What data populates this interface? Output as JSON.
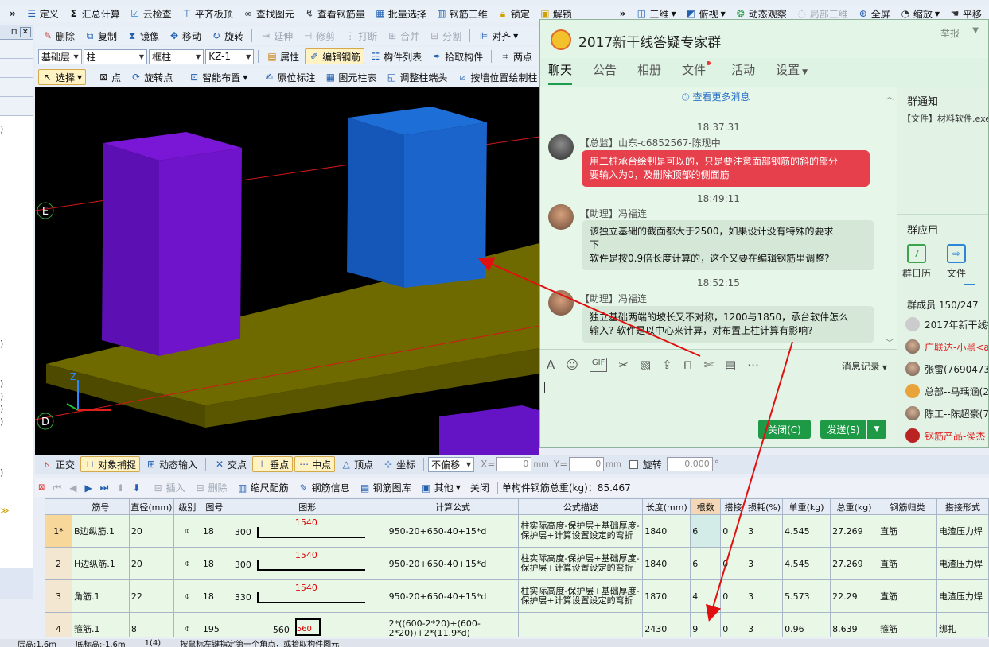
{
  "toolbar1": {
    "items": [
      "定义",
      "汇总计算",
      "云检查",
      "平齐板顶",
      "查找图元",
      "查看钢筋量",
      "批量选择",
      "钢筋三维",
      "锁定",
      "解锁"
    ],
    "right_items": [
      "三维",
      "俯视",
      "动态观察",
      "局部三维",
      "全屏",
      "缩放",
      "平移"
    ]
  },
  "toolbar2": {
    "items": [
      "删除",
      "复制",
      "镜像",
      "移动",
      "旋转",
      "延伸",
      "修剪",
      "打断",
      "合并",
      "分割",
      "对齐"
    ]
  },
  "toolbar3": {
    "layer": "基础层",
    "type": "柱",
    "subtype": "框柱",
    "component": "KZ-1",
    "items": [
      "属性",
      "编辑钢筋",
      "构件列表",
      "拾取构件",
      "两点"
    ]
  },
  "toolbar4": {
    "items": [
      "选择",
      "点",
      "旋转点",
      "智能布置",
      "原位标注",
      "图元柱表",
      "调整柱端头",
      "按墙位置绘制柱"
    ]
  },
  "viewport": {
    "axis_e": "E",
    "axis_d": "D",
    "z_label": "Z"
  },
  "snapbar": {
    "items": [
      "正交",
      "对象捕捉",
      "动态输入",
      "交点",
      "垂点",
      "中点",
      "顶点",
      "坐标"
    ],
    "offset_mode": "不偏移",
    "x_label": "X=",
    "x_value": "0",
    "x_unit": "mm",
    "y_label": "Y=",
    "y_value": "0",
    "y_unit": "mm",
    "rotate_label": "旋转",
    "rotate_value": "0.000",
    "rotate_unit": "°"
  },
  "rebarbar": {
    "items": [
      "插入",
      "删除",
      "缩尺配筋",
      "钢筋信息",
      "钢筋图库",
      "其他",
      "关闭"
    ],
    "total": "单构件钢筋总重(kg)：85.467"
  },
  "table": {
    "headers": [
      "",
      "筋号",
      "直径(mm)",
      "级别",
      "图号",
      "图形",
      "计算公式",
      "公式描述",
      "长度(mm)",
      "根数",
      "搭接",
      "损耗(%)",
      "单重(kg)",
      "总重(kg)",
      "钢筋归类",
      "搭接形式"
    ],
    "rows": [
      {
        "idx": "1*",
        "name": "B边纵筋.1",
        "dia": "20",
        "grade": "⌽",
        "fig": "18",
        "shape_left": "300",
        "shape_top": "1540",
        "formula": "950-20+650-40+15*d",
        "desc": "柱实际高度-保护层+基础厚度-保护层+计算设置设定的弯折",
        "len": "1840",
        "count": "6",
        "lap": "0",
        "loss": "3",
        "unit_w": "4.545",
        "total_w": "27.269",
        "cat": "直筋",
        "lap_type": "电渣压力焊"
      },
      {
        "idx": "2",
        "name": "H边纵筋.1",
        "dia": "20",
        "grade": "⌽",
        "fig": "18",
        "shape_left": "300",
        "shape_top": "1540",
        "formula": "950-20+650-40+15*d",
        "desc": "柱实际高度-保护层+基础厚度-保护层+计算设置设定的弯折",
        "len": "1840",
        "count": "6",
        "lap": "0",
        "loss": "3",
        "unit_w": "4.545",
        "total_w": "27.269",
        "cat": "直筋",
        "lap_type": "电渣压力焊"
      },
      {
        "idx": "3",
        "name": "角筋.1",
        "dia": "22",
        "grade": "⌽",
        "fig": "18",
        "shape_left": "330",
        "shape_top": "1540",
        "formula": "950-20+650-40+15*d",
        "desc": "柱实际高度-保护层+基础厚度-保护层+计算设置设定的弯折",
        "len": "1870",
        "count": "4",
        "lap": "0",
        "loss": "3",
        "unit_w": "5.573",
        "total_w": "22.29",
        "cat": "直筋",
        "lap_type": "电渣压力焊"
      },
      {
        "idx": "4",
        "name": "箍筋.1",
        "dia": "8",
        "grade": "⌽",
        "fig": "195",
        "shape_left": "560",
        "shape_top": "560",
        "formula": "2*((600-2*20)+(600-2*20))+2*(11.9*d)",
        "desc": "",
        "len": "2430",
        "count": "9",
        "lap": "0",
        "loss": "3",
        "unit_w": "0.96",
        "total_w": "8.639",
        "cat": "箍筋",
        "lap_type": "绑扎"
      }
    ]
  },
  "status": {
    "items": [
      "层高:1.6m",
      "底标高:-1.6m",
      "1(4)",
      "按鼠标左键指定第一个角点，或拾取构件图元"
    ]
  },
  "qq": {
    "group_name": "2017新干线答疑专家群",
    "report": "举报",
    "tabs": [
      "聊天",
      "公告",
      "相册",
      "文件",
      "活动",
      "设置"
    ],
    "more_messages": "查看更多消息",
    "messages": [
      {
        "time": "18:37:31",
        "sender": "【总监】山东-c6852567-陈现中",
        "lines": [
          "用二桩承台绘制是可以的，只是要注意面部钢筋的斜的部分",
          "要输入为0，及删除顶部的侧面筋"
        ]
      },
      {
        "time": "18:49:11",
        "sender": "【助理】冯福连",
        "lines": [
          "该独立基础的截面都大于2500，如果设计没有特殊的要求",
          "下",
          "软件是按0.9倍长度计算的，这个又要在编辑钢筋里调整?"
        ]
      },
      {
        "time": "18:52:15",
        "sender": "【助理】冯福连",
        "lines": [
          "独立基础两端的坡长又不对称，1200与1850，承台软件怎么",
          "输入? 软件是以中心来计算，对布置上柱计算有影响?"
        ]
      }
    ],
    "history": "消息记录",
    "close_btn": "关闭(C)",
    "send_btn": "发送(S)",
    "side": {
      "notice_title": "群通知",
      "notice_text": "【文件】材料软件.exe",
      "apps_title": "群应用",
      "apps": [
        "群日历",
        "文件"
      ],
      "members_title": "群成员 150/247",
      "members": [
        "2017年新干线答",
        "广联达-小黑<a",
        "张雷(76904734",
        "总部--马瑀涵(2",
        "陈工--陈超豪(7",
        "钢筋产品-侯杰"
      ]
    }
  }
}
